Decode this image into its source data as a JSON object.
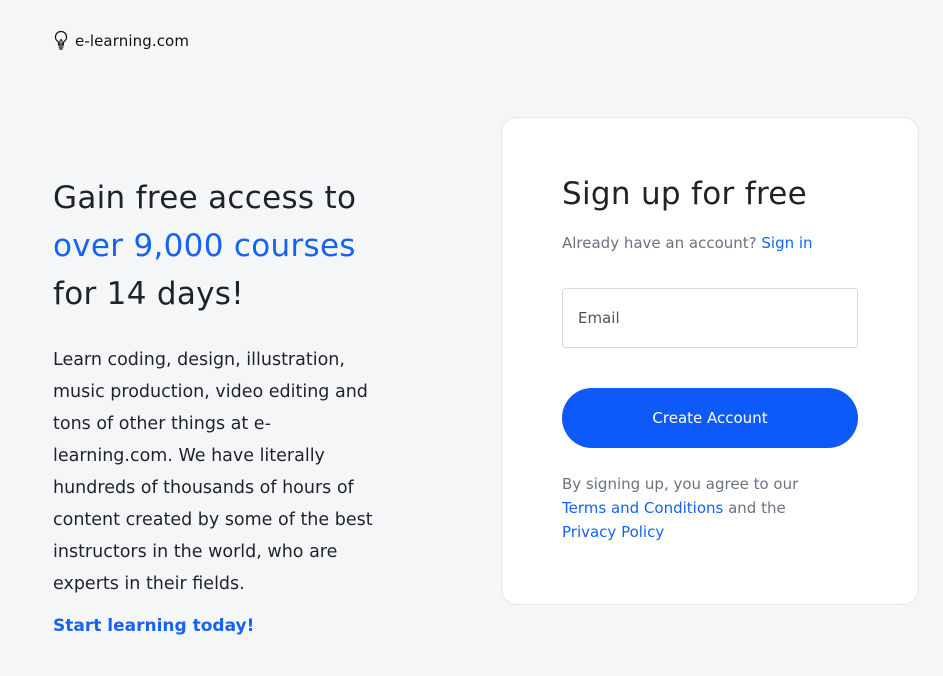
{
  "brand": {
    "name": "e-learning.com",
    "icon": "lightbulb-icon"
  },
  "hero": {
    "line1": "Gain free access to",
    "line2": "over 9,000 courses",
    "line3": "for 14 days!",
    "description": "Learn coding, design, illustration, music production, video editing and tons of other things at e-learning.com. We have literally hundreds of thousands of hours of content created by some of the best instructors in the world, who are experts in their fields.",
    "cta": "Start learning today!"
  },
  "signup": {
    "title": "Sign up for free",
    "already_text": "Already have an account?",
    "signin_link": "Sign in",
    "email_placeholder": "Email",
    "email_value": "",
    "create_button": "Create Account",
    "terms_prefix": "By signing up, you agree to our",
    "terms_link": "Terms and Conditions",
    "terms_middle": "and the",
    "privacy_link": "Privacy Policy"
  },
  "colors": {
    "accent": "#1463f3",
    "button": "#0d5af8",
    "background": "#f5f6f8",
    "card": "#ffffff"
  }
}
